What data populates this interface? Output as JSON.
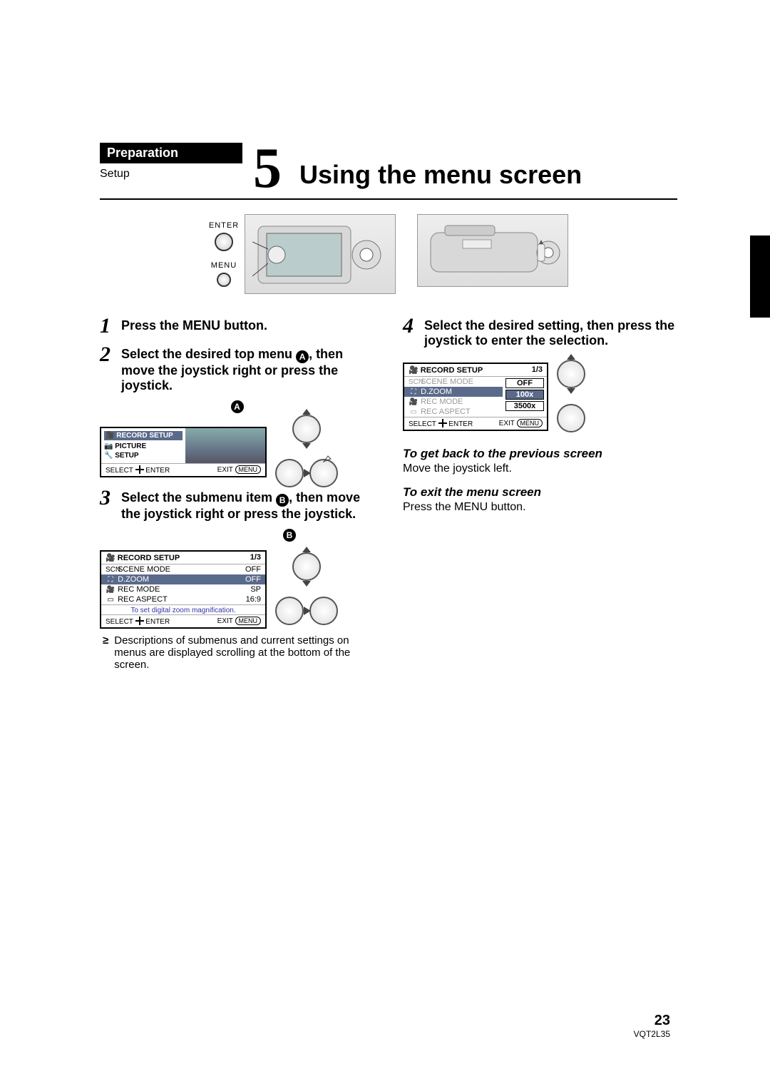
{
  "header": {
    "preparation": "Preparation",
    "setup": "Setup",
    "chapter_number": "5",
    "title": "Using the menu screen"
  },
  "labels": {
    "enter": "ENTER",
    "menu": "MENU",
    "select": "SELECT",
    "enter_short": "ENTER",
    "exit": "EXIT",
    "menu_pill": "MENU"
  },
  "steps": {
    "s1": {
      "num": "1",
      "text": "Press the MENU button."
    },
    "s2": {
      "num": "2",
      "text_pre": "Select the desired top menu ",
      "badge": "A",
      "text_post": ", then move the joystick right or press the joystick."
    },
    "s3": {
      "num": "3",
      "text_pre": "Select the submenu item ",
      "badge": "B",
      "text_post": ", then move the joystick right or press the joystick."
    },
    "s4": {
      "num": "4",
      "text": "Select the desired setting, then press the joystick to enter the selection."
    }
  },
  "screenA": {
    "badge": "A",
    "items": [
      "RECORD SETUP",
      "PICTURE",
      "SETUP"
    ]
  },
  "screenB": {
    "badge": "B",
    "title": "RECORD SETUP",
    "page": "1/3",
    "rows": [
      {
        "label": "SCENE MODE",
        "value": "OFF"
      },
      {
        "label": "D.ZOOM",
        "value": "OFF",
        "hl": true
      },
      {
        "label": "REC MODE",
        "value": "SP"
      },
      {
        "label": "REC ASPECT",
        "value": "16:9"
      }
    ],
    "tip": "To set digital zoom magnification."
  },
  "note_bullet": "Descriptions of submenus and current settings on menus are displayed scrolling at the bottom of the screen.",
  "screenC": {
    "title": "RECORD SETUP",
    "page": "1/3",
    "rows": [
      {
        "label": "SCENE MODE",
        "dim": true
      },
      {
        "label": "D.ZOOM",
        "options": [
          "OFF",
          "100x",
          "3500x"
        ],
        "sel": 1
      },
      {
        "label": "REC MODE",
        "dim": true
      },
      {
        "label": "REC ASPECT",
        "dim": true
      }
    ]
  },
  "tips": {
    "back_title": "To get back to the previous screen",
    "back_body": "Move the joystick left.",
    "exit_title": "To exit the menu screen",
    "exit_body": "Press the MENU button."
  },
  "footer": {
    "page": "23",
    "doc": "VQT2L35"
  }
}
